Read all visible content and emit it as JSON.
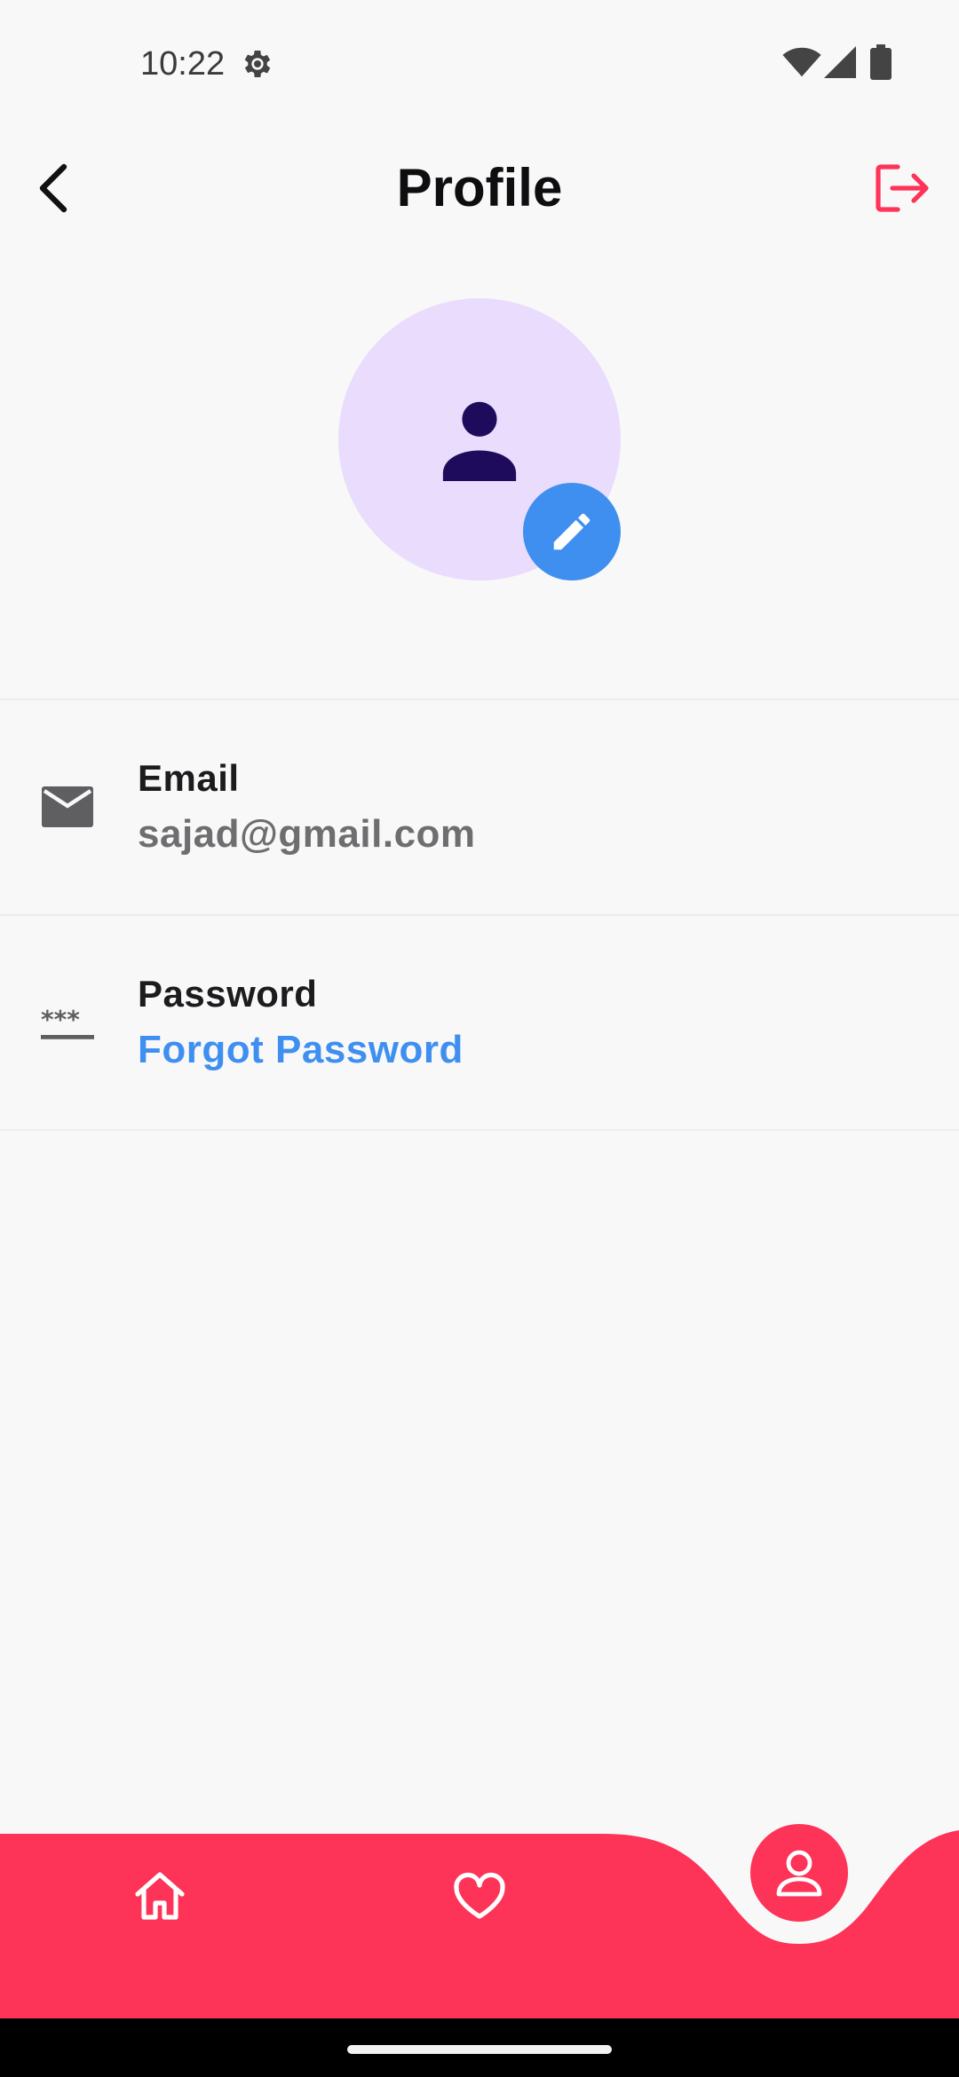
{
  "status_bar": {
    "time": "10:22",
    "icons": [
      "gear-icon",
      "wifi-icon",
      "signal-icon",
      "battery-icon"
    ]
  },
  "app_bar": {
    "title": "Profile",
    "back_icon": "chevron-left-icon",
    "logout_icon": "logout-icon"
  },
  "avatar": {
    "icon": "person-icon",
    "edit_icon": "pencil-icon"
  },
  "info": [
    {
      "icon": "mail-icon",
      "title": "Email",
      "value": "sajad@gmail.com"
    },
    {
      "icon": "password-icon",
      "title": "Password",
      "value": "Forgot Password"
    }
  ],
  "bottom_nav": {
    "items": [
      "home-icon",
      "heart-icon",
      "profile-icon"
    ],
    "active": "profile-icon"
  },
  "colors": {
    "accent": "#fd3358",
    "link": "#3f8ff0",
    "avatar_bg": "#eadcfd",
    "avatar_fg": "#1e0b5c",
    "background": "#f8f8f9",
    "secondary_text": "#6e6e70"
  }
}
